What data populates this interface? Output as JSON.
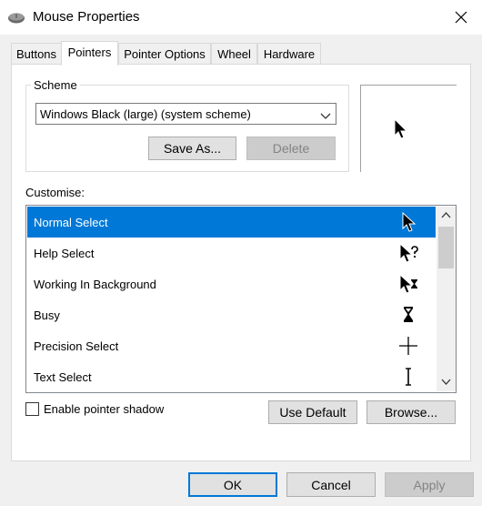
{
  "window": {
    "title": "Mouse Properties"
  },
  "tabs": [
    {
      "label": "Buttons"
    },
    {
      "label": "Pointers"
    },
    {
      "label": "Pointer Options"
    },
    {
      "label": "Wheel"
    },
    {
      "label": "Hardware"
    }
  ],
  "active_tab": "Pointers",
  "scheme": {
    "label": "Scheme",
    "selected": "Windows Black (large) (system scheme)",
    "save_as_label": "Save As...",
    "delete_label": "Delete"
  },
  "customise": {
    "label": "Customise:",
    "items": [
      {
        "label": "Normal Select",
        "icon": "arrow-cursor-icon",
        "selected": true
      },
      {
        "label": "Help Select",
        "icon": "help-cursor-icon"
      },
      {
        "label": "Working In Background",
        "icon": "working-cursor-icon"
      },
      {
        "label": "Busy",
        "icon": "hourglass-cursor-icon"
      },
      {
        "label": "Precision Select",
        "icon": "crosshair-cursor-icon"
      },
      {
        "label": "Text Select",
        "icon": "ibeam-cursor-icon"
      }
    ]
  },
  "shadow": {
    "label": "Enable pointer shadow",
    "checked": false
  },
  "buttons": {
    "use_default": "Use Default",
    "browse": "Browse...",
    "ok": "OK",
    "cancel": "Cancel",
    "apply": "Apply"
  },
  "colors": {
    "selection": "#0078d7",
    "default_button_border": "#0078d7"
  }
}
